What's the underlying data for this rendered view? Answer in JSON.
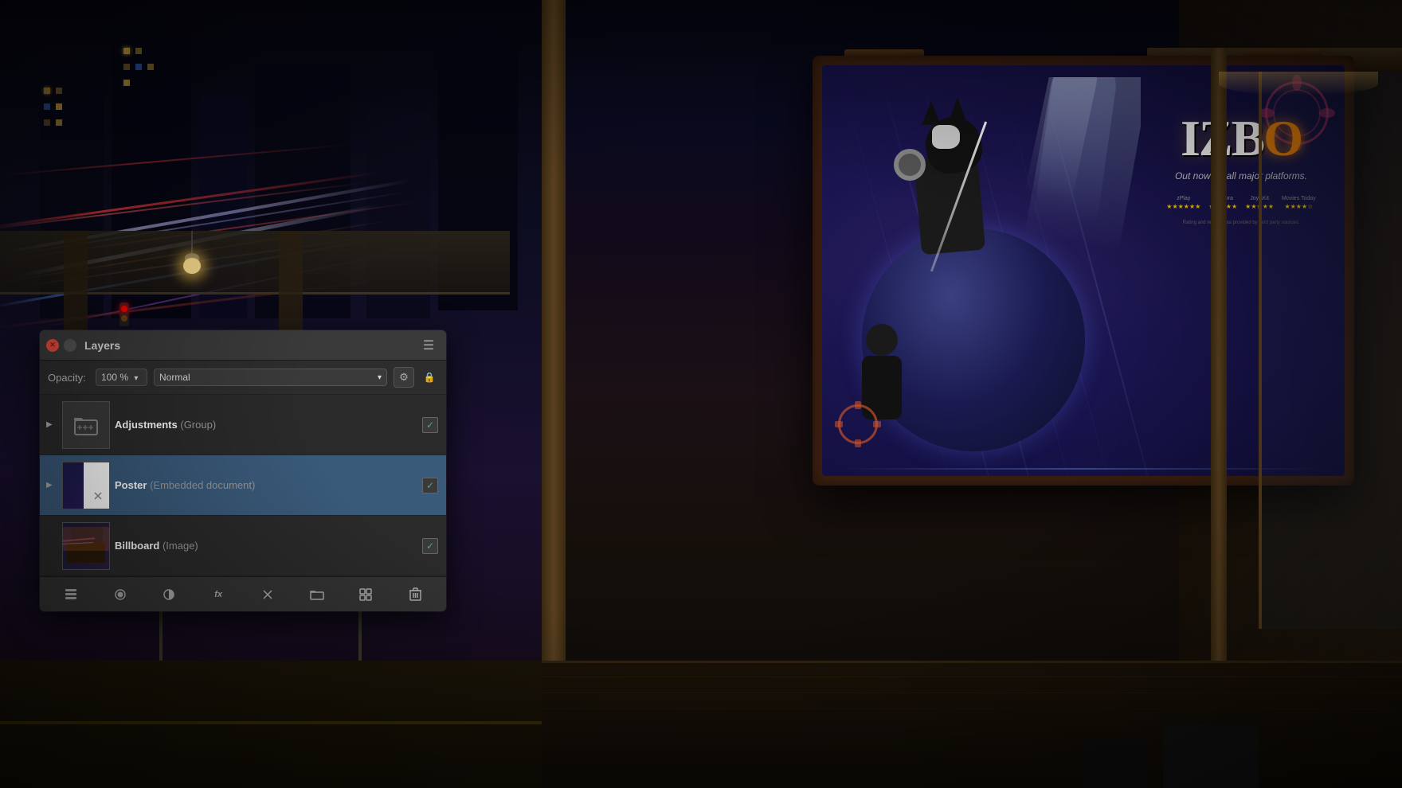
{
  "background": {
    "description": "Night city street with bus stop billboard"
  },
  "billboard": {
    "game_title_1": "IZB",
    "game_title_2": "O",
    "tagline": "Out now on all major platforms.",
    "reviews": [
      {
        "source": "zPlay",
        "stars": "★★★★★★"
      },
      {
        "source": "Gamora",
        "stars": "★★★★★"
      },
      {
        "source": "JoyAKit",
        "stars": "★★★★★"
      },
      {
        "source": "Movies Today",
        "stars": "★★★★"
      }
    ]
  },
  "layers_panel": {
    "title": "Layers",
    "opacity_label": "Opacity:",
    "opacity_value": "100 %",
    "blend_mode": "Normal",
    "close_btn": "×",
    "minimize_btn": "–",
    "menu_btn": "☰",
    "settings_icon": "⚙",
    "lock_icon": "🔒",
    "layers": [
      {
        "name": "Adjustments",
        "type": "(Group)",
        "visible": true,
        "has_arrow": true,
        "thumb_type": "adjustments"
      },
      {
        "name": "Poster",
        "type": "(Embedded document)",
        "visible": true,
        "has_arrow": true,
        "thumb_type": "poster",
        "selected": true
      },
      {
        "name": "Billboard",
        "type": "(Image)",
        "visible": true,
        "has_arrow": false,
        "thumb_type": "billboard"
      }
    ],
    "toolbar_buttons": [
      {
        "id": "layers-btn",
        "icon": "⊞",
        "label": "layers"
      },
      {
        "id": "circle-btn",
        "icon": "◉",
        "label": "circle"
      },
      {
        "id": "half-circle-btn",
        "icon": "◑",
        "label": "half-circle"
      },
      {
        "id": "fx-btn",
        "icon": "fx",
        "label": "fx"
      },
      {
        "id": "cross-btn",
        "icon": "✕",
        "label": "cross"
      },
      {
        "id": "folder-btn",
        "icon": "▭",
        "label": "folder"
      },
      {
        "id": "grid-btn",
        "icon": "⊞",
        "label": "grid"
      },
      {
        "id": "trash-btn",
        "icon": "🗑",
        "label": "trash"
      }
    ]
  },
  "colors": {
    "panel_bg": "#2d2d2d",
    "panel_header": "#3a3a3a",
    "selected_layer": "#3a5a7a",
    "close_btn": "#e74c3c",
    "billboard_bg": "#1a1a4a",
    "accent_orange": "#ff8800"
  }
}
